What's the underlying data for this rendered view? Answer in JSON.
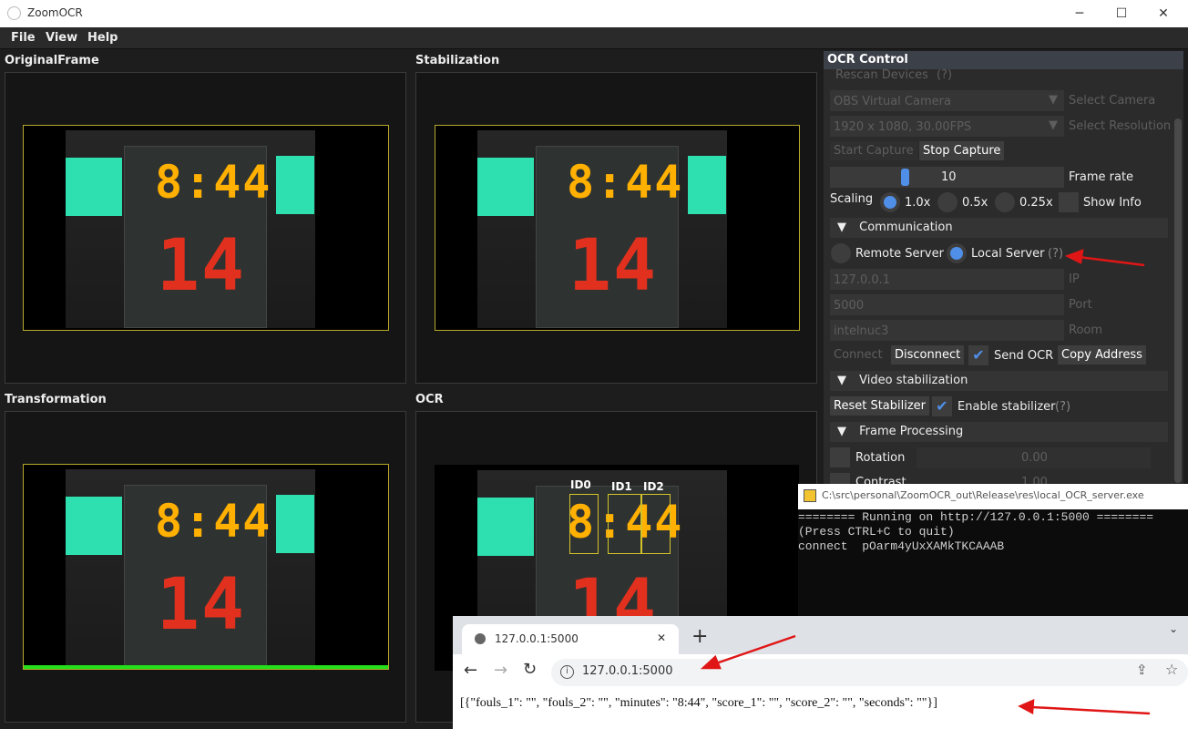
{
  "window": {
    "title": "ZoomOCR",
    "minimize": "─",
    "maximize": "☐",
    "close": "✕"
  },
  "menu": [
    "File",
    "View",
    "Help"
  ],
  "panels": {
    "original": "OriginalFrame",
    "stabilization": "Stabilization",
    "transformation": "Transformation",
    "ocr": "OCR"
  },
  "scoreboard": {
    "time": "8:44",
    "number": "14"
  },
  "ocr_ids": [
    "ID0",
    "ID1",
    "ID2"
  ],
  "control": {
    "header": "OCR Control",
    "rescan": "Rescan Devices",
    "rescan_help": "(?)",
    "camera_value": "OBS Virtual Camera",
    "camera_label": "Select Camera",
    "resolution_value": "1920 x 1080, 30.00FPS",
    "resolution_label": "Select Resolution",
    "start_capture": "Start Capture",
    "stop_capture": "Stop Capture",
    "frame_rate_value": "10",
    "frame_rate_label": "Frame rate",
    "scaling_label": "Scaling",
    "scaling_options": [
      "1.0x",
      "0.5x",
      "0.25x"
    ],
    "scaling_selected": "1.0x",
    "show_info": "Show Info",
    "communication": "Communication",
    "remote_server": "Remote Server",
    "local_server": "Local Server",
    "server_help": "(?)",
    "ip_value": "127.0.0.1",
    "ip_label": "IP",
    "port_value": "5000",
    "port_label": "Port",
    "room_value": "intelnuc3",
    "room_label": "Room",
    "connect": "Connect",
    "disconnect": "Disconnect",
    "send_ocr": "Send OCR",
    "copy_address": "Copy Address",
    "video_stabilization": "Video stabilization",
    "reset_stabilizer": "Reset Stabilizer",
    "enable_stabilizer": "Enable stabilizer",
    "stab_help": "(?)",
    "frame_processing": "Frame Processing",
    "rotation_label": "Rotation",
    "rotation_value": "0.00",
    "contrast_label": "Contrast",
    "contrast_value": "1.00"
  },
  "console": {
    "title": "C:\\src\\personal\\ZoomOCR_out\\Release\\res\\local_OCR_server.exe",
    "lines": [
      "======== Running on http://127.0.0.1:5000 ========",
      "(Press CTRL+C to quit)",
      "connect  pOarm4yUxXAMkTKCAAAB"
    ]
  },
  "browser": {
    "tab_title": "127.0.0.1:5000",
    "new_tab": "+",
    "url": "127.0.0.1:5000",
    "body": "[{\"fouls_1\": \"\", \"fouls_2\": \"\", \"minutes\": \"8:44\", \"score_1\": \"\", \"score_2\": \"\", \"seconds\": \"\"}]"
  },
  "colors": {
    "accent": "#4f8fe8",
    "frame_outline": "#b8a92a",
    "teal": "#2ee0b0",
    "digit_top": "#ffb000",
    "digit_bottom": "#e2301e",
    "arrow": "#e01616",
    "progress_green": "#22e01a"
  }
}
